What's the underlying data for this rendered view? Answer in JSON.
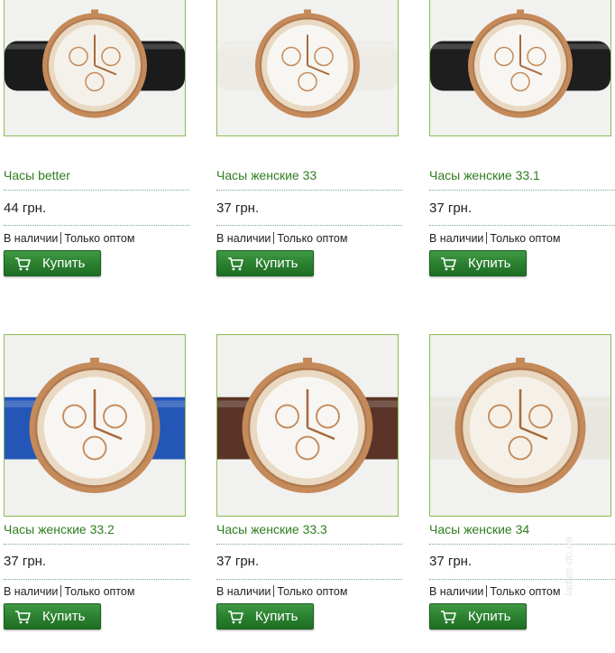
{
  "products": [
    {
      "name": "Часы better",
      "price": "44 грн.",
      "availability": "В наличии",
      "wholesale": "Только оптом",
      "buy_label": "Купить",
      "strap_color": "#1b1b1b",
      "dial_color": "#f4f1ea"
    },
    {
      "name": "Часы женские 33",
      "price": "37 грн.",
      "availability": "В наличии",
      "wholesale": "Только оптом",
      "buy_label": "Купить",
      "strap_color": "#ecebe6",
      "dial_color": "#f7f6f2"
    },
    {
      "name": "Часы женские 33.1",
      "price": "37 грн.",
      "availability": "В наличии",
      "wholesale": "Только оптом",
      "buy_label": "Купить",
      "strap_color": "#1e1e1e",
      "dial_color": "#f7f6f2"
    },
    {
      "name": "Часы женские 33.2",
      "price": "37 грн.",
      "availability": "В наличии",
      "wholesale": "Только оптом",
      "buy_label": "Купить",
      "strap_color": "#2456b8",
      "dial_color": "#f7f6f2"
    },
    {
      "name": "Часы женские 33.3",
      "price": "37 грн.",
      "availability": "В наличии",
      "wholesale": "Только оптом",
      "buy_label": "Купить",
      "strap_color": "#5a3426",
      "dial_color": "#f7f6f2"
    },
    {
      "name": "Часы женские 34",
      "price": "37 грн.",
      "availability": "В наличии",
      "wholesale": "Только оптом",
      "buy_label": "Купить",
      "strap_color": "#e8e6df",
      "dial_color": "#f5f1e8"
    }
  ],
  "watermark": "ladies-do.ua",
  "colors": {
    "accent_green": "#2a7f2f",
    "link_green": "#2f7d1f",
    "border_green": "#8bbd54",
    "case_gold": "#c58a5a"
  },
  "icons": {
    "cart": "cart-icon"
  }
}
